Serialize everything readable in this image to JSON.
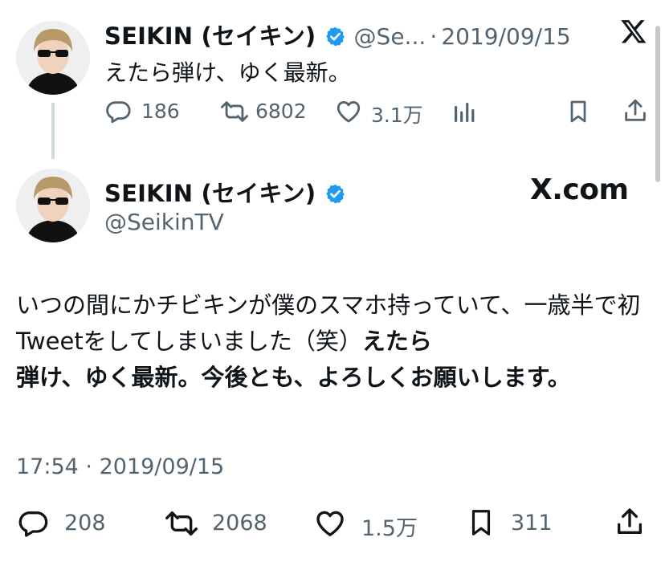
{
  "quoted_tweet": {
    "display_name": "SEIKIN (セイキン)",
    "handle": "@Se...",
    "separator": "·",
    "date": "2019/09/15",
    "text": "えたら弾け、ゆく最新。",
    "replies": "186",
    "retweets": "6802",
    "likes": "3.1万"
  },
  "main_tweet": {
    "display_name": "SEIKIN (セイキン)",
    "handle": "@SeikinTV",
    "brand": "X.com",
    "text_plain": "いつの間にかチビキンが僕のスマホ持っていて、一歳半で初Tweetをしてしまいました（笑）",
    "text_bold_1": "えたら",
    "text_bold_2": "弾け、ゆく最新。今後とも、よろしくお願いします。",
    "time": "17:54",
    "separator": "·",
    "date": "2019/09/15",
    "replies": "208",
    "retweets": "2068",
    "likes": "1.5万",
    "bookmarks": "311"
  },
  "colors": {
    "verified": "#1d9bf0",
    "text": "#0f1419",
    "secondary": "#536471",
    "thread_line": "#cfd9de"
  },
  "icons": [
    "x-logo-icon",
    "verified-badge-icon",
    "reply-icon",
    "retweet-icon",
    "like-icon",
    "views-icon",
    "bookmark-icon",
    "share-icon"
  ]
}
